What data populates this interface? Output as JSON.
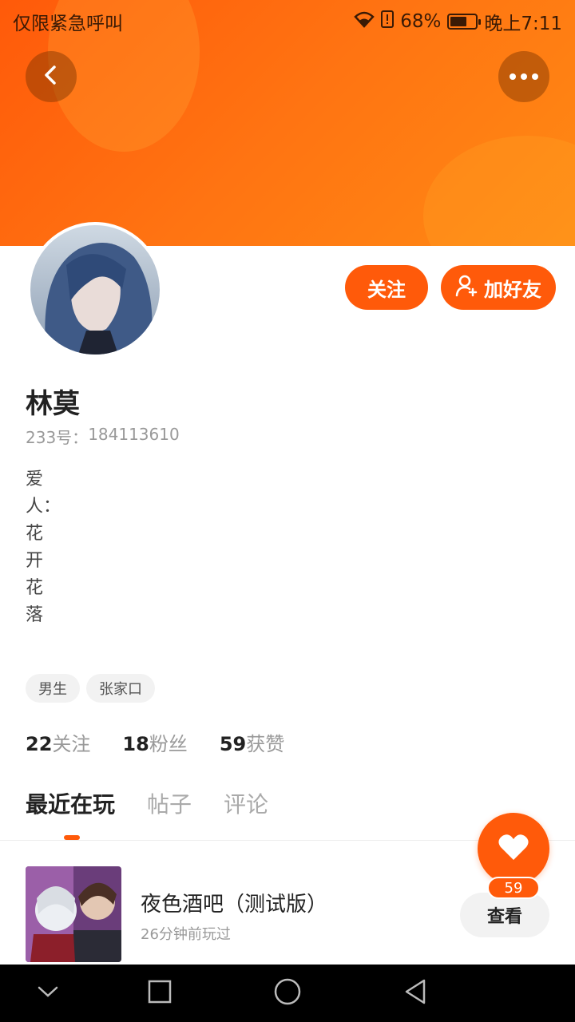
{
  "status_bar": {
    "left_text": "仅限紧急呼叫",
    "battery": "68%",
    "battery_level": 0.68,
    "time": "晚上7:11"
  },
  "header": {
    "back_icon": "back-icon",
    "more_icon": "more-icon"
  },
  "actions": {
    "follow_label": "关注",
    "add_friend_label": "加好友"
  },
  "profile": {
    "name": "林莫",
    "id_label": "233号：",
    "id_value": "184113610",
    "bio": "爱人：花开花落",
    "tags": [
      "男生",
      "张家口"
    ]
  },
  "stats": [
    {
      "num": "22",
      "label": "关注"
    },
    {
      "num": "18",
      "label": "粉丝"
    },
    {
      "num": "59",
      "label": "获赞"
    }
  ],
  "tabs": [
    "最近在玩",
    "帖子",
    "评论"
  ],
  "recent_game": {
    "title": "夜色酒吧（测试版）",
    "time": "26分钟前玩过",
    "view_label": "查看"
  },
  "like_fab": {
    "count": "59"
  },
  "colors": {
    "accent": "#ff5a0a",
    "banner_end": "#ff8a14"
  }
}
